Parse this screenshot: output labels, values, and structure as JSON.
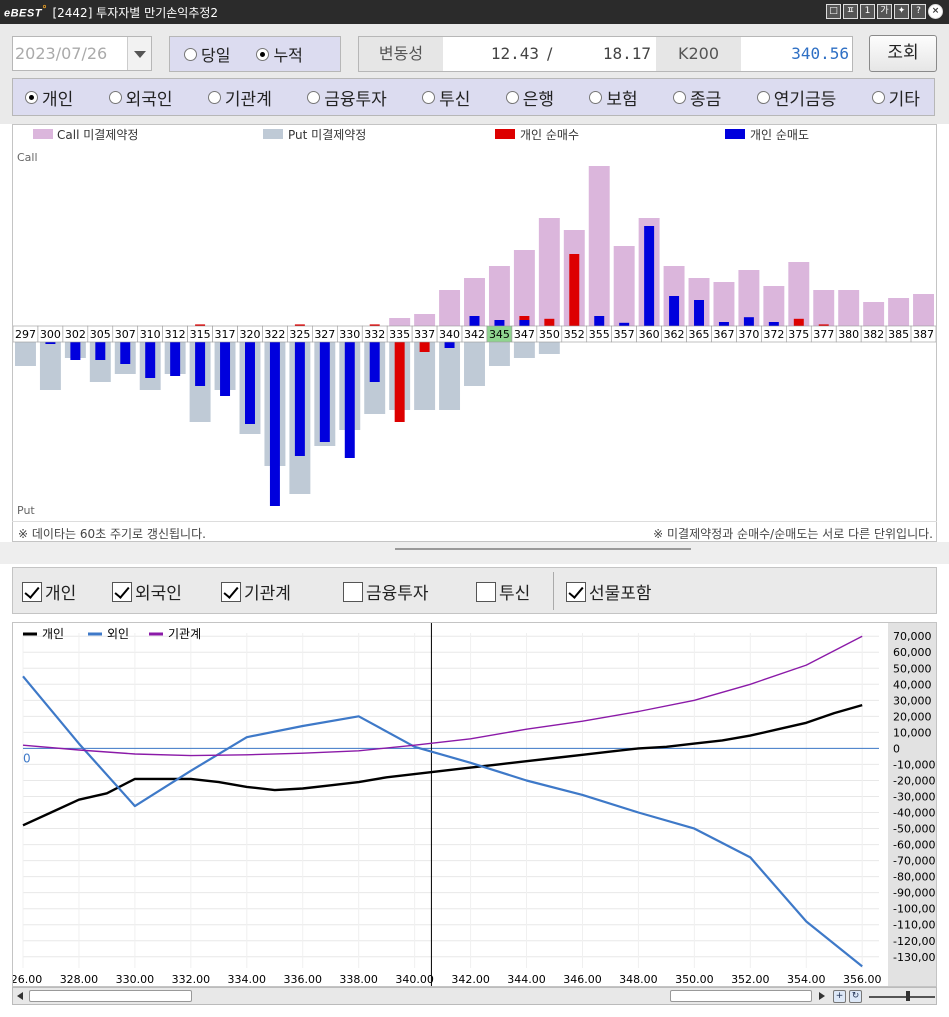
{
  "window": {
    "logo": "eBEST",
    "title": "[2442] 투자자별 만기손익추정2",
    "buttons": [
      "□",
      "ㅍ",
      "1",
      "가",
      "✦",
      "?"
    ]
  },
  "toolbar": {
    "date": "2023/07/26",
    "mode_options": [
      {
        "label": "당일",
        "selected": false
      },
      {
        "label": "누적",
        "selected": true
      }
    ],
    "volatility_label": "변동성",
    "volatility_call": "12.43",
    "volatility_sep": "/",
    "volatility_put": "18.17",
    "index_label": "K200",
    "index_value": "340.56",
    "query_button": "조회"
  },
  "investors": [
    {
      "label": "개인",
      "selected": true
    },
    {
      "label": "외국인",
      "selected": false
    },
    {
      "label": "기관계",
      "selected": false
    },
    {
      "label": "금융투자",
      "selected": false
    },
    {
      "label": "투신",
      "selected": false
    },
    {
      "label": "은행",
      "selected": false
    },
    {
      "label": "보험",
      "selected": false
    },
    {
      "label": "종금",
      "selected": false
    },
    {
      "label": "연기금등",
      "selected": false
    },
    {
      "label": "기타",
      "selected": false
    }
  ],
  "oi_chart": {
    "legend": [
      "Call 미결제약정",
      "Put 미결제약정",
      "개인 순매수",
      "개인 순매도"
    ],
    "top_label": "Call",
    "bottom_label": "Put",
    "footer_left": "※ 데이타는 60초 주기로 갱신됩니다.",
    "footer_right": "※ 미결제약정과 순매수/순매도는 서로 다른 단위입니다."
  },
  "checks": [
    {
      "label": "개인",
      "checked": true
    },
    {
      "label": "외국인",
      "checked": true
    },
    {
      "label": "기관계",
      "checked": true
    },
    {
      "label": "금융투자",
      "checked": false
    },
    {
      "label": "투신",
      "checked": false
    },
    {
      "label": "선물포함",
      "checked": true
    }
  ],
  "colors": {
    "call_oi": "#dbb6dc",
    "put_oi": "#bfcad6",
    "net_buy": "#dd0000",
    "net_sell": "#0000dd",
    "personal": "#000000",
    "foreign": "#3e79c8",
    "institution": "#8b1aa8",
    "atm_highlight": "#8fd48f"
  },
  "chart_data": [
    {
      "type": "bar",
      "categories": [
        "297",
        "300",
        "302",
        "305",
        "307",
        "310",
        "312",
        "315",
        "317",
        "320",
        "322",
        "325",
        "327",
        "330",
        "332",
        "335",
        "337",
        "340",
        "342",
        "345",
        "347",
        "350",
        "352",
        "355",
        "357",
        "360",
        "362",
        "365",
        "367",
        "370",
        "372",
        "375",
        "377",
        "380",
        "382",
        "385",
        "387"
      ],
      "highlight_category": "345",
      "series": [
        {
          "name": "Call 미결제약정",
          "values": [
            0,
            0,
            0,
            0,
            0,
            0,
            0,
            0,
            0,
            0,
            0,
            0,
            0,
            0,
            0,
            2,
            3,
            9,
            12,
            15,
            19,
            27,
            24,
            40,
            20,
            27,
            15,
            12,
            11,
            14,
            10,
            16,
            9,
            9,
            6,
            7,
            8
          ]
        },
        {
          "name": "Put 미결제약정",
          "values": [
            -6,
            -12,
            -4,
            -10,
            -8,
            -12,
            -8,
            -20,
            -12,
            -23,
            -31,
            -38,
            -26,
            -22,
            -18,
            -17,
            -17,
            -17,
            -11,
            -6,
            -4,
            -3,
            0,
            0,
            0,
            0,
            0,
            0,
            0,
            0,
            0,
            0,
            0,
            0,
            0,
            0,
            0
          ]
        },
        {
          "name": "개인 순매수",
          "values": [
            0,
            0,
            0,
            0,
            0,
            0,
            0,
            0.4,
            0,
            0,
            0,
            0.4,
            0,
            0,
            0.4,
            -20,
            -2.5,
            0,
            0,
            0,
            2.5,
            1.8,
            18,
            0,
            0,
            0,
            0,
            0,
            0,
            0,
            0,
            1.8,
            0.4,
            0,
            0,
            0,
            0
          ]
        },
        {
          "name": "개인 순매도",
          "values": [
            0,
            -0.5,
            -4.5,
            -4.5,
            -5.5,
            -9,
            -8.5,
            -11,
            -13.5,
            -20.5,
            -41,
            -28.5,
            -25,
            -29,
            -10,
            0,
            0,
            -1.5,
            2.5,
            1.5,
            1.5,
            0,
            0,
            2.5,
            0.8,
            25,
            7.5,
            6.5,
            1,
            2.2,
            1,
            0,
            0,
            0,
            0,
            0,
            0
          ]
        }
      ]
    },
    {
      "type": "line",
      "x": [
        326,
        328,
        330,
        332,
        334,
        336,
        338,
        340,
        342,
        344,
        346,
        348,
        350,
        352,
        354,
        356
      ],
      "xlim": [
        326,
        356.6
      ],
      "ylim": [
        -137000,
        72000
      ],
      "xticks": [
        "326.00",
        "328.00",
        "330.00",
        "332.00",
        "334.00",
        "336.00",
        "338.00",
        "340.00",
        "342.00",
        "344.00",
        "346.00",
        "348.00",
        "350.00",
        "352.00",
        "354.00",
        "356.00"
      ],
      "yticks": [
        "70,000",
        "60,000",
        "50,000",
        "40,000",
        "30,000",
        "20,000",
        "10,000",
        "0",
        "-10,000",
        "-20,000",
        "-30,000",
        "-40,000",
        "-50,000",
        "-60,000",
        "-70,000",
        "-80,000",
        "-90,000",
        "-100,000",
        "-110,000",
        "-120,000",
        "-130,000"
      ],
      "zero_label": "0",
      "cursor_x": 340.6,
      "series": [
        {
          "name": "개인",
          "x": [
            326,
            327,
            328,
            329,
            330,
            331,
            332,
            333,
            334,
            335,
            336,
            337,
            338,
            339,
            340,
            341,
            342,
            343,
            344,
            345,
            346,
            347,
            348,
            349,
            350,
            351,
            352,
            353,
            354,
            355,
            356
          ],
          "values": [
            -48000,
            -40000,
            -32000,
            -28000,
            -19000,
            -19000,
            -19000,
            -21000,
            -24000,
            -26000,
            -25000,
            -23000,
            -21000,
            -18000,
            -16000,
            -14000,
            -12000,
            -10000,
            -8000,
            -6000,
            -4000,
            -2000,
            0,
            1000,
            3000,
            5000,
            8000,
            12000,
            16000,
            22000,
            27000
          ]
        },
        {
          "name": "외인",
          "x": [
            326,
            328,
            330,
            332,
            334,
            336,
            338,
            340,
            342,
            344,
            346,
            348,
            350,
            352,
            354,
            356
          ],
          "values": [
            45000,
            3000,
            -36000,
            -14000,
            7000,
            14000,
            20000,
            1000,
            -9000,
            -20000,
            -29000,
            -40000,
            -50000,
            -68000,
            -108000,
            -136000
          ]
        },
        {
          "name": "기관계",
          "x": [
            326,
            328,
            330,
            332,
            334,
            336,
            338,
            340,
            342,
            344,
            346,
            348,
            350,
            352,
            354,
            356
          ],
          "values": [
            2000,
            -1000,
            -3500,
            -4500,
            -4000,
            -3000,
            -1500,
            2000,
            6000,
            12000,
            17000,
            23000,
            30000,
            40000,
            52000,
            70000
          ]
        }
      ]
    }
  ]
}
